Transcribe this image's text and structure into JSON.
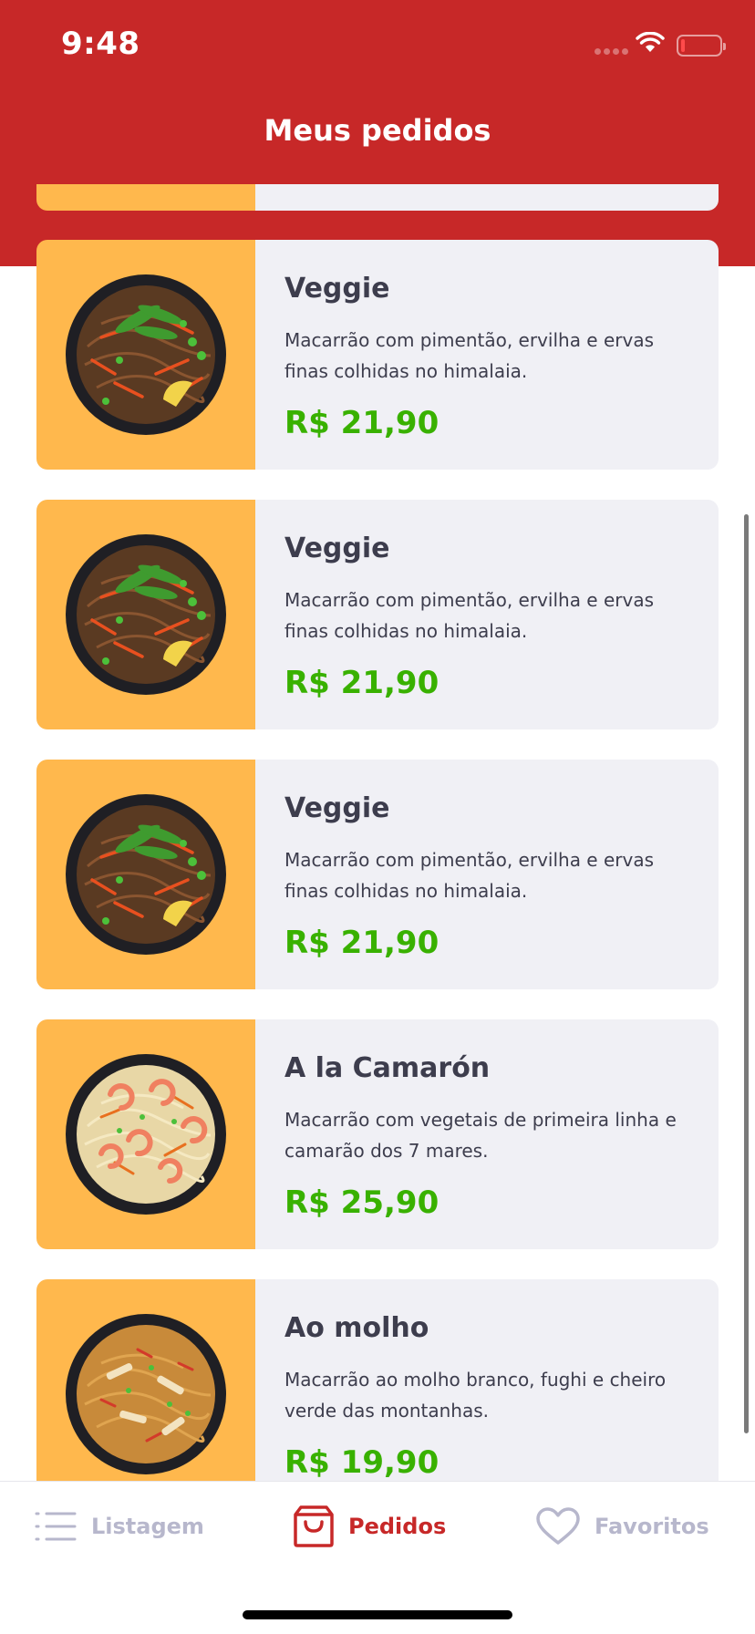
{
  "status_bar": {
    "time": "9:48"
  },
  "header": {
    "title": "Meus pedidos"
  },
  "orders": [
    {
      "title": "Veggie",
      "description": "Macarrão com pimentão, ervilha e ervas finas colhidas no himalaia.",
      "price": "R$ 21,90",
      "image": "veggie-pasta"
    },
    {
      "title": "Veggie",
      "description": "Macarrão com pimentão, ervilha e ervas finas colhidas no himalaia.",
      "price": "R$ 21,90",
      "image": "veggie-pasta"
    },
    {
      "title": "Veggie",
      "description": "Macarrão com pimentão, ervilha e ervas finas colhidas no himalaia.",
      "price": "R$ 21,90",
      "image": "veggie-pasta"
    },
    {
      "title": "A la Camarón",
      "description": "Macarrão com vegetais de primeira linha e camarão dos 7 mares.",
      "price": "R$ 25,90",
      "image": "shrimp-pasta"
    },
    {
      "title": "Ao molho",
      "description": "Macarrão ao molho branco, fughi e cheiro verde das montanhas.",
      "price": "R$ 19,90",
      "image": "sauce-pasta"
    }
  ],
  "tabbar": {
    "listagem": {
      "label": "Listagem",
      "icon": "list-icon"
    },
    "pedidos": {
      "label": "Pedidos",
      "icon": "shopping-bag-icon"
    },
    "favoritos": {
      "label": "Favoritos",
      "icon": "heart-icon"
    }
  },
  "colors": {
    "primary": "#C72828",
    "accent": "#FFB84D",
    "price": "#39B100",
    "card_bg": "#F0F0F5",
    "text": "#3D3D4D",
    "tab_inactive": "#B7B7CC"
  }
}
